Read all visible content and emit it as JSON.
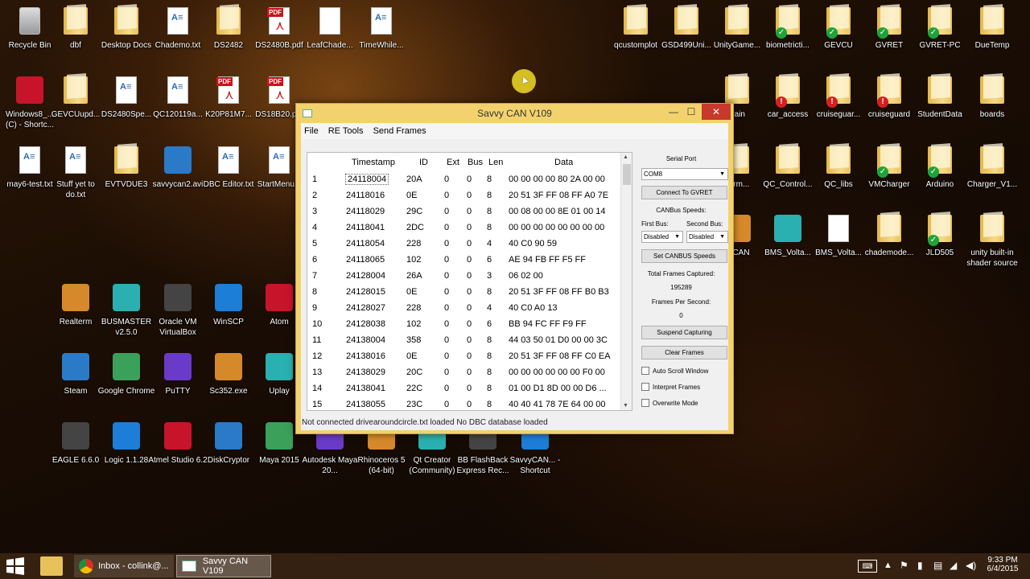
{
  "desktop": {
    "icons_left": [
      {
        "label": "Recycle Bin",
        "type": "recycle"
      },
      {
        "label": "dbf",
        "type": "folder"
      },
      {
        "label": "Desktop Docs",
        "type": "folder"
      },
      {
        "label": "Chademo.txt",
        "type": "txt"
      },
      {
        "label": "DS2482",
        "type": "folder"
      },
      {
        "label": "DS2480B.pdf",
        "type": "pdf"
      },
      {
        "label": "LeafChade...",
        "type": "doc"
      },
      {
        "label": "TimeWhile...",
        "type": "txt"
      },
      {
        "label": "Windows8_... (C) - Shortc...",
        "type": "app"
      },
      {
        "label": "GEVCUupd...",
        "type": "folder"
      },
      {
        "label": "DS2480Spe...",
        "type": "txt"
      },
      {
        "label": "QC120119a...",
        "type": "txt"
      },
      {
        "label": "K20P81M7...",
        "type": "pdf"
      },
      {
        "label": "DS18B20.p...",
        "type": "pdf"
      },
      {
        "label": "may6-test.txt",
        "type": "txt"
      },
      {
        "label": "Stuff yet to do.txt",
        "type": "txt"
      },
      {
        "label": "EVTVDUE3",
        "type": "folder"
      },
      {
        "label": "savvycan2.avi",
        "type": "app"
      },
      {
        "label": "DBC Editor.txt",
        "type": "txt"
      },
      {
        "label": "StartMenu...",
        "type": "txt"
      },
      {
        "label": "Realterm",
        "type": "app"
      },
      {
        "label": "BUSMASTER v2.5.0",
        "type": "app"
      },
      {
        "label": "Oracle VM VirtualBox",
        "type": "app"
      },
      {
        "label": "WinSCP",
        "type": "app"
      },
      {
        "label": "Atom",
        "type": "app"
      },
      {
        "label": "Steam",
        "type": "app"
      },
      {
        "label": "Google Chrome",
        "type": "app"
      },
      {
        "label": "PuTTY",
        "type": "app"
      },
      {
        "label": "Sc352.exe",
        "type": "app"
      },
      {
        "label": "Uplay",
        "type": "app"
      },
      {
        "label": "EAGLE 6.6.0",
        "type": "app"
      },
      {
        "label": "Logic 1.1.28",
        "type": "app"
      },
      {
        "label": "Atmel Studio 6.2",
        "type": "app"
      },
      {
        "label": "DiskCryptor",
        "type": "app"
      },
      {
        "label": "Maya 2015",
        "type": "app"
      },
      {
        "label": "Autodesk Maya 20...",
        "type": "app"
      },
      {
        "label": "Rhinoceros 5 (64-bit)",
        "type": "app"
      },
      {
        "label": "Qt Creator (Community)",
        "type": "app"
      },
      {
        "label": "BB FlashBack Express Rec...",
        "type": "app"
      },
      {
        "label": "SavvyCAN... - Shortcut",
        "type": "app"
      }
    ],
    "icons_right": [
      {
        "label": "qcustomplot",
        "type": "folder"
      },
      {
        "label": "GSD499Uni...",
        "type": "folder"
      },
      {
        "label": "UnityGame...",
        "type": "folder"
      },
      {
        "label": "biometricti...",
        "type": "folder"
      },
      {
        "label": "GEVCU",
        "type": "folder"
      },
      {
        "label": "GVRET",
        "type": "folder"
      },
      {
        "label": "GVRET-PC",
        "type": "folder"
      },
      {
        "label": "DueTemp",
        "type": "folder"
      },
      {
        "label": "rrain",
        "type": "folder"
      },
      {
        "label": "car_access",
        "type": "folder"
      },
      {
        "label": "cruiseguar...",
        "type": "folder"
      },
      {
        "label": "cruiseguard",
        "type": "folder"
      },
      {
        "label": "StudentData",
        "type": "folder"
      },
      {
        "label": "boards",
        "type": "folder"
      },
      {
        "label": "efirm...",
        "type": "folder"
      },
      {
        "label": "QC_Control...",
        "type": "folder"
      },
      {
        "label": "QC_libs",
        "type": "folder"
      },
      {
        "label": "VMCharger",
        "type": "folder"
      },
      {
        "label": "Arduino",
        "type": "folder"
      },
      {
        "label": "Charger_V1...",
        "type": "folder"
      },
      {
        "label": "vyCAN",
        "type": "app"
      },
      {
        "label": "BMS_Volta...",
        "type": "app"
      },
      {
        "label": "BMS_Volta...",
        "type": "doc"
      },
      {
        "label": "chademode...",
        "type": "folder"
      },
      {
        "label": "JLD505",
        "type": "folder"
      },
      {
        "label": "unity built-in shader source",
        "type": "folder"
      }
    ]
  },
  "window": {
    "title": "Savvy CAN V109",
    "min": "—",
    "max": "☐",
    "close": "✕",
    "menu": [
      "File",
      "RE Tools",
      "Send Frames"
    ],
    "columns": [
      "Timestamp",
      "ID",
      "Ext",
      "Bus",
      "Len",
      "Data"
    ],
    "rows": [
      [
        "1",
        "24118004",
        "20A",
        "0",
        "0",
        "8",
        "00 00 00 00 80 2A 00 00"
      ],
      [
        "2",
        "24118016",
        "0E",
        "0",
        "0",
        "8",
        "20 51 3F FF 08 FF A0 7E"
      ],
      [
        "3",
        "24118029",
        "29C",
        "0",
        "0",
        "8",
        "00 08 00 00 8E 01 00 14"
      ],
      [
        "4",
        "24118041",
        "2DC",
        "0",
        "0",
        "8",
        "00 00 00 00 00 00 00 00"
      ],
      [
        "5",
        "24118054",
        "228",
        "0",
        "0",
        "4",
        "40 C0 90 59"
      ],
      [
        "6",
        "24118065",
        "102",
        "0",
        "0",
        "6",
        "AE 94 FB FF F5 FF"
      ],
      [
        "7",
        "24128004",
        "26A",
        "0",
        "0",
        "3",
        "06 02 00"
      ],
      [
        "8",
        "24128015",
        "0E",
        "0",
        "0",
        "8",
        "20 51 3F FF 08 FF B0 B3"
      ],
      [
        "9",
        "24128027",
        "228",
        "0",
        "0",
        "4",
        "40 C0 A0 13"
      ],
      [
        "10",
        "24128038",
        "102",
        "0",
        "0",
        "6",
        "BB 94 FC FF F9 FF"
      ],
      [
        "11",
        "24138004",
        "358",
        "0",
        "0",
        "8",
        "44 03 50 01 D0 00 00 3C"
      ],
      [
        "12",
        "24138016",
        "0E",
        "0",
        "0",
        "8",
        "20 51 3F FF 08 FF C0 EA"
      ],
      [
        "13",
        "24138029",
        "20C",
        "0",
        "0",
        "8",
        "00 00 00 00 00 00 F0 00"
      ],
      [
        "14",
        "24138041",
        "22C",
        "0",
        "0",
        "8",
        "01 00 D1 8D 00 00 D6 ..."
      ],
      [
        "15",
        "24138055",
        "23C",
        "0",
        "0",
        "8",
        "40 40 41 78 7E 64 00 00"
      ]
    ],
    "side": {
      "serial_port_label": "Serial Port",
      "serial_port_value": "COM8",
      "connect_button": "Connect To GVRET",
      "canbus_speeds_label": "CANBus Speeds:",
      "first_bus_label": "First Bus:",
      "second_bus_label": "Second Bus:",
      "first_bus_value": "Disabled",
      "second_bus_value": "Disabled",
      "set_speeds_button": "Set CANBUS Speeds",
      "total_frames_label": "Total Frames Captured:",
      "total_frames_value": "195289",
      "fps_label": "Frames Per Second:",
      "fps_value": "0",
      "suspend_button": "Suspend Capturing",
      "clear_button": "Clear Frames",
      "auto_scroll_label": "Auto Scroll Window",
      "interpret_label": "Interpret Frames",
      "overwrite_label": "Overwrite Mode"
    },
    "status": "Not connected  drivearoundcircle.txt loaded  No DBC database loaded"
  },
  "taskbar": {
    "items": [
      {
        "label": "Inbox - collink@..."
      },
      {
        "label": "Savvy CAN V109"
      }
    ],
    "time": "9:33 PM",
    "date": "6/4/2015"
  }
}
